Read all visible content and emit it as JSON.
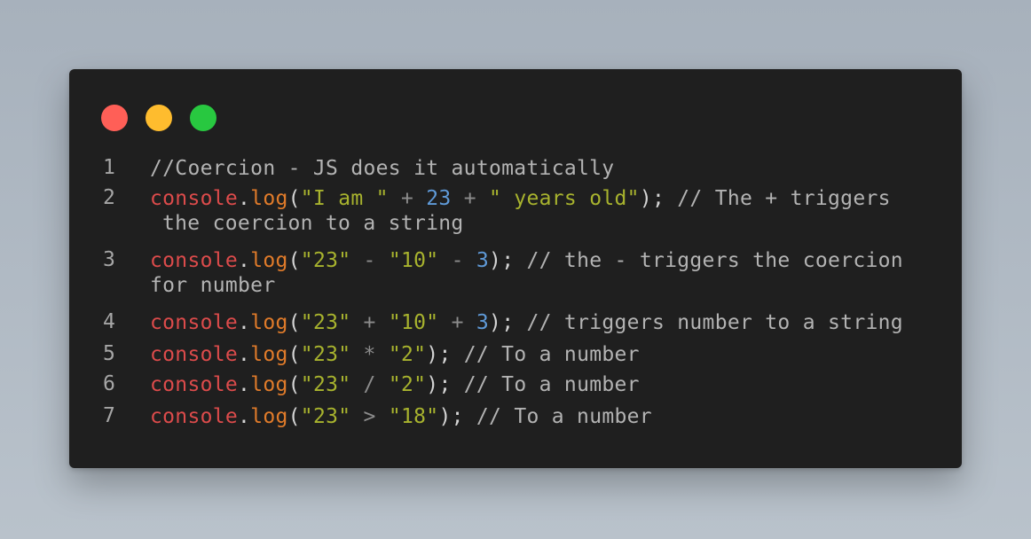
{
  "window": {
    "traffic_lights": [
      {
        "name": "close",
        "color": "#ff5f57"
      },
      {
        "name": "minimize",
        "color": "#febc2e"
      },
      {
        "name": "maximize",
        "color": "#28c840"
      }
    ]
  },
  "code": {
    "lines": [
      {
        "number": "1",
        "comment": "//Coercion - JS does it automatically"
      },
      {
        "number": "2",
        "obj": "console",
        "dot": ".",
        "fn": "log",
        "open": "(",
        "s1": "\"I am \"",
        "op1": " + ",
        "n1": "23",
        "op2": " + ",
        "s2": "\" years old\"",
        "close": ");",
        "comment": " // The + triggers",
        "comment_cont": "the coercion to a string"
      },
      {
        "number": "3",
        "obj": "console",
        "dot": ".",
        "fn": "log",
        "open": "(",
        "s1": "\"23\"",
        "op1": " - ",
        "s2": "\"10\"",
        "op2": " - ",
        "n1": "3",
        "close": ");",
        "comment": " // the - triggers the coercion",
        "comment_cont": "for number"
      },
      {
        "number": "4",
        "obj": "console",
        "dot": ".",
        "fn": "log",
        "open": "(",
        "s1": "\"23\"",
        "op1": " + ",
        "s2": "\"10\"",
        "op2": " + ",
        "n1": "3",
        "close": ");",
        "comment": " // triggers number to a string"
      },
      {
        "number": "5",
        "obj": "console",
        "dot": ".",
        "fn": "log",
        "open": "(",
        "s1": "\"23\"",
        "op1": " * ",
        "s2": "\"2\"",
        "close": ");",
        "comment": " // To a number"
      },
      {
        "number": "6",
        "obj": "console",
        "dot": ".",
        "fn": "log",
        "open": "(",
        "s1": "\"23\"",
        "op1": " / ",
        "s2": "\"2\"",
        "close": ");",
        "comment": " // To a number"
      },
      {
        "number": "7",
        "obj": "console",
        "dot": ".",
        "fn": "log",
        "open": "(",
        "s1": "\"23\"",
        "op1": " > ",
        "s2": "\"18\"",
        "close": ");",
        "comment": " // To a number"
      }
    ]
  }
}
